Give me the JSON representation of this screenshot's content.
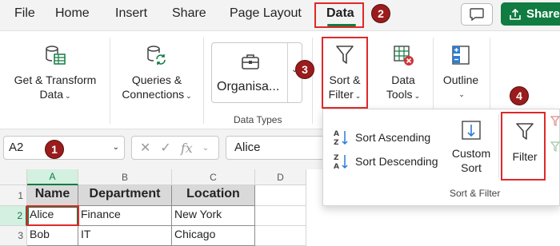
{
  "menu": {
    "tabs": [
      {
        "label": "File"
      },
      {
        "label": "Home"
      },
      {
        "label": "Insert"
      },
      {
        "label": "Share"
      },
      {
        "label": "Page Layout"
      },
      {
        "label": "Data"
      }
    ],
    "share_label": "Share"
  },
  "ribbon": {
    "get_transform": {
      "line1": "Get & Transform",
      "line2": "Data"
    },
    "queries": {
      "line1": "Queries &",
      "line2": "Connections"
    },
    "datatypes": {
      "value": "Organisa...",
      "group_label": "Data Types"
    },
    "sort_filter": {
      "line1": "Sort &",
      "line2": "Filter"
    },
    "data_tools": {
      "line1": "Data",
      "line2": "Tools"
    },
    "outline": {
      "line1": "Outline"
    }
  },
  "dropdown": {
    "sort_ascending": "Sort Ascending",
    "sort_descending": "Sort Descending",
    "custom_sort_line1": "Custom",
    "custom_sort_line2": "Sort",
    "filter": "Filter",
    "group_label": "Sort & Filter"
  },
  "formula_bar": {
    "name_box": "A2",
    "fx": "fx",
    "value": "Alice"
  },
  "grid": {
    "columns": [
      "A",
      "B",
      "C",
      "D"
    ],
    "rows": [
      "1",
      "2",
      "3"
    ],
    "headers": [
      "Name",
      "Department",
      "Location"
    ],
    "data": [
      [
        "Alice",
        "Finance",
        "New York"
      ],
      [
        "Bob",
        "IT",
        "Chicago"
      ]
    ]
  },
  "badges": [
    "1",
    "2",
    "3",
    "4"
  ],
  "colors": {
    "accent": "#107c41",
    "highlight": "#e0282a",
    "badge": "#9b1c1c"
  }
}
